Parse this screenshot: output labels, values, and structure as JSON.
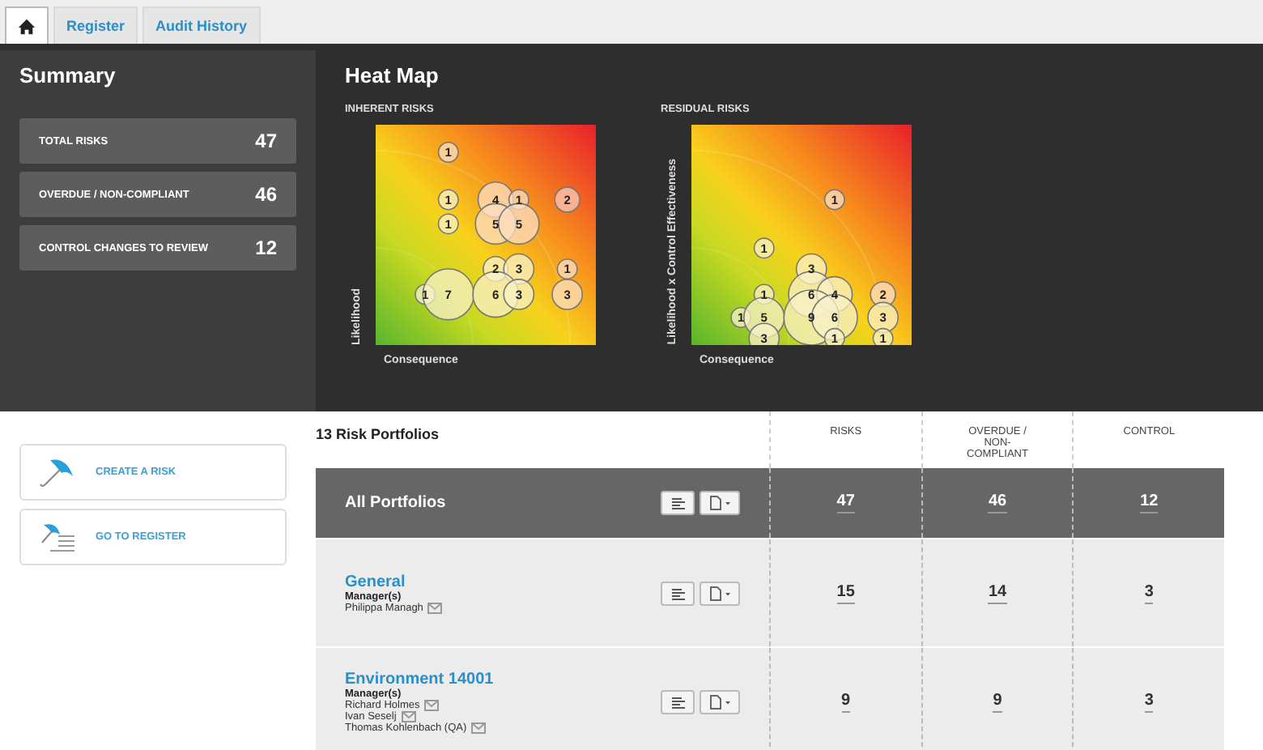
{
  "tabs": [
    {
      "kind": "home",
      "selected": true
    },
    {
      "kind": "text",
      "label": "Register",
      "selected": false
    },
    {
      "kind": "text",
      "label": "Audit History",
      "selected": false
    }
  ],
  "summary": {
    "title": "Summary",
    "items": [
      {
        "label": "TOTAL RISKS",
        "value": "47"
      },
      {
        "label": "OVERDUE / NON-COMPLIANT",
        "value": "46"
      },
      {
        "label": "CONTROL CHANGES TO REVIEW",
        "value": "12"
      }
    ]
  },
  "heat_map": {
    "title": "Heat Map",
    "maps": [
      {
        "title": "INHERENT RISKS",
        "ylabel": "Likelihood",
        "xlabel": "Consequence",
        "rows": [
          [
            null,
            "1",
            null,
            null,
            null
          ],
          [
            null,
            "1",
            "4",
            "1",
            "2"
          ],
          [
            null,
            "1",
            "5",
            "5",
            null
          ],
          [
            null,
            null,
            null,
            null,
            null
          ],
          [
            null,
            null,
            "2",
            "3",
            "1"
          ],
          [
            "1",
            "7",
            "6",
            "3",
            "3"
          ],
          [
            null,
            null,
            null,
            null,
            null
          ],
          [
            null,
            null,
            null,
            null,
            null
          ]
        ]
      },
      {
        "title": "RESIDUAL RISKS",
        "ylabel": "Likelihood x Control Effectiveness",
        "xlabel": "Consequence",
        "rows": [
          [
            null,
            null,
            null,
            null,
            null
          ],
          [
            null,
            null,
            null,
            "1",
            null
          ],
          [
            null,
            null,
            null,
            null,
            null
          ],
          [
            null,
            "1",
            null,
            null,
            null
          ],
          [
            null,
            null,
            "3",
            null,
            null
          ],
          [
            null,
            "1",
            "6",
            "4",
            "2"
          ],
          [
            "1",
            "5",
            "9",
            "6",
            "3"
          ],
          [
            null,
            "3",
            null,
            "1",
            "1"
          ]
        ]
      }
    ]
  },
  "actions": [
    {
      "kind": "umbrella",
      "label": "CREATE A RISK"
    },
    {
      "kind": "register",
      "label": "GO TO REGISTER"
    }
  ],
  "portfolios": {
    "title": "13 Risk Portfolios",
    "columns": [
      "RISKS",
      "OVERDUE / NON-COMPLIANT",
      "CONTROL"
    ],
    "rows": [
      {
        "kind": "total",
        "name": "All Portfolios",
        "managers": [],
        "values": [
          "47",
          "46",
          "12"
        ]
      },
      {
        "kind": "portfolio",
        "name": "General",
        "managers_label": "Manager(s)",
        "managers": [
          "Philippa Managh"
        ],
        "values": [
          "15",
          "14",
          "3"
        ]
      },
      {
        "kind": "portfolio",
        "name": "Environment 14001",
        "managers_label": "Manager(s)",
        "managers": [
          "Richard Holmes",
          "Ivan Seselj",
          "Thomas Kohlenbach (QA)"
        ],
        "values": [
          "9",
          "9",
          "3"
        ]
      }
    ]
  }
}
